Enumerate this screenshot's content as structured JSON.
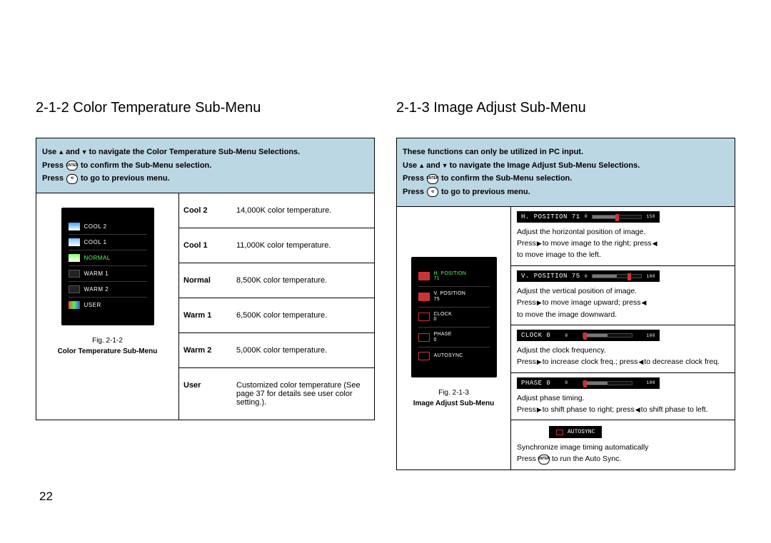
{
  "page_number": "22",
  "left": {
    "heading": "2-1-2 Color Temperature Sub-Menu",
    "instructions": {
      "l1a": "Use ",
      "l1b": " and ",
      "l1c": " to navigate the Color Temperature Sub-Menu Selections.",
      "l2a": "Press ",
      "l2b": " to confirm the Sub-Menu selection.",
      "l3a": "Press ",
      "l3b": " to go to previous menu."
    },
    "osd": {
      "items": [
        {
          "label": "COOL 2"
        },
        {
          "label": "COOL 1"
        },
        {
          "label": "NORMAL",
          "selected": true
        },
        {
          "label": "WARM 1"
        },
        {
          "label": "WARM 2"
        },
        {
          "label": "USER"
        }
      ]
    },
    "fig_num": "Fig. 2-1-2",
    "fig_caption": "Color Temperature Sub-Menu",
    "rows": [
      {
        "label": "Cool 2",
        "desc": "14,000K color temperature."
      },
      {
        "label": "Cool 1",
        "desc": "11,000K color temperature."
      },
      {
        "label": "Normal",
        "desc": "8,500K color temperature."
      },
      {
        "label": "Warm 1",
        "desc": "6,500K color temperature."
      },
      {
        "label": "Warm 2",
        "desc": "5,000K color temperature."
      },
      {
        "label": "User",
        "desc": "Customized color temperature (See page 37 for details see user color setting.)."
      }
    ]
  },
  "right": {
    "heading": "2-1-3 Image Adjust Sub-Menu",
    "instructions": {
      "l0": "These functions can only be utilized in PC input.",
      "l1a": "Use ",
      "l1b": " and ",
      "l1c": " to navigate the Image Adjust Sub-Menu Selections.",
      "l2a": "Press ",
      "l2b": " to confirm the Sub-Menu selection.",
      "l3a": "Press ",
      "l3b": " to go to previous menu."
    },
    "osd": {
      "items": [
        {
          "l1": "H. POSITION",
          "l2": "71",
          "selected": true
        },
        {
          "l1": "V. POSITION",
          "l2": "75"
        },
        {
          "l1": "CLOCK",
          "l2": "0"
        },
        {
          "l1": "PHASE",
          "l2": "0"
        },
        {
          "l1": "AUTOSYNC",
          "l2": ""
        }
      ]
    },
    "fig_num": "Fig. 2-1-3",
    "fig_caption": "Image Adjust Sub-Menu",
    "details": {
      "hpos_bar_label": "H. POSITION  71",
      "hpos_bar_min": "0",
      "hpos_bar_max": "150",
      "hpos_d1": "Adjust the horizontal position of image.",
      "hpos_d2a": "Press ",
      "hpos_d2b": " to move image to the right; press ",
      "hpos_d2c": " to move image to the left.",
      "vpos_bar_label": "V. POSITION  75",
      "vpos_bar_min": "0",
      "vpos_bar_max": "100",
      "vpos_d1": "Adjust the vertical position of image.",
      "vpos_d2a": "Press ",
      "vpos_d2b": " to move image upward; press ",
      "vpos_d2c": " to move the image downward.",
      "clock_bar_label": "CLOCK         0",
      "clock_bar_min": "0",
      "clock_bar_max": "100",
      "clock_d1": "Adjust the clock frequency.",
      "clock_d2a": "Press ",
      "clock_d2b": " to increase clock freq.; press ",
      "clock_d2c": " to decrease clock freq.",
      "phase_bar_label": "PHASE         0",
      "phase_bar_min": "0",
      "phase_bar_max": "100",
      "phase_d1": "Adjust phase timing.",
      "phase_d2a": "Press ",
      "phase_d2b": " to shift phase to right; press ",
      "phase_d2c": " to shift phase to left.",
      "autosync_btn": "AUTOSYNC",
      "as_d1": "Synchronize image timing automatically",
      "as_d2a": "Press ",
      "as_d2b": " to run the Auto Sync."
    }
  }
}
